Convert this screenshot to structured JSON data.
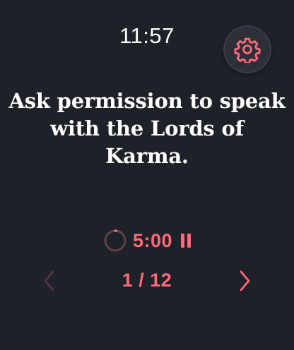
{
  "status": {
    "time": "11:57"
  },
  "settings": {
    "icon": "gear-icon",
    "color": "#ff6b78"
  },
  "prompt": {
    "text": "Ask permission to speak\nwith the Lords of\nKarma."
  },
  "timer": {
    "remaining": "5:00",
    "progress": 0,
    "pause_icon": "pause-icon"
  },
  "pager": {
    "current": 1,
    "total": 12,
    "label": "1 / 12",
    "prev_icon": "chevron-left-icon",
    "next_icon": "chevron-right-icon",
    "prev_enabled": false,
    "next_enabled": true
  },
  "colors": {
    "background": "#1f2128",
    "accent": "#ff6b78",
    "text": "#ffffff",
    "disabled": "#4a3a41"
  }
}
